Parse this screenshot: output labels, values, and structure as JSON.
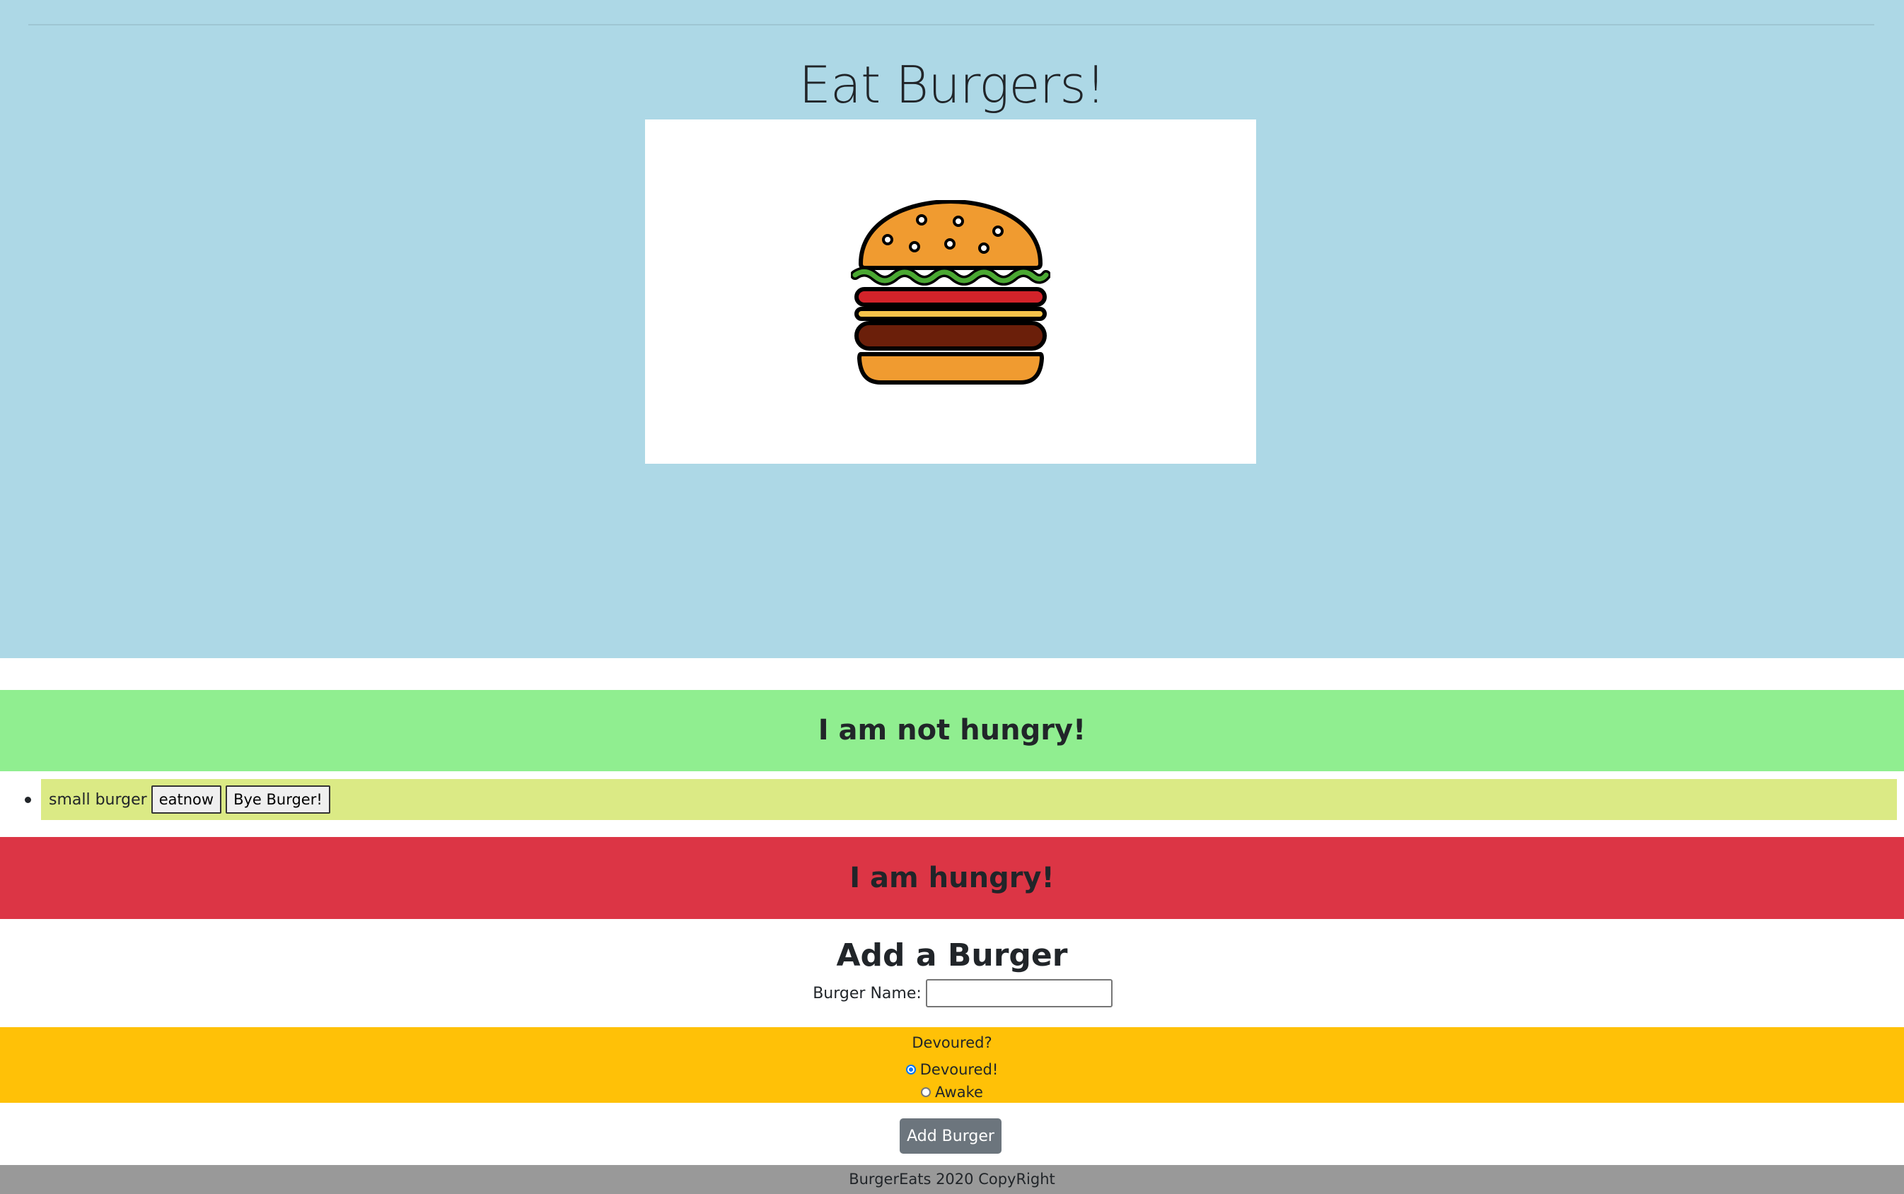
{
  "header": {
    "title": "Eat Burgers!"
  },
  "sections": {
    "not_hungry_title": "I am not hungry!",
    "hungry_title": "I am hungry!"
  },
  "burgers": [
    {
      "name": "small burger",
      "eat_label": "eatnow",
      "delete_label": "Bye Burger!"
    }
  ],
  "form": {
    "title": "Add a Burger",
    "name_label": "Burger Name:",
    "name_value": "",
    "devoured_legend": "Devoured?",
    "options": [
      {
        "label": "Devoured!",
        "checked": true
      },
      {
        "label": "Awake",
        "checked": false
      }
    ],
    "submit_label": "Add Burger"
  },
  "footer": {
    "text": "BurgerEats 2020 CopyRight"
  },
  "colors": {
    "jumbotron": "#add8e6",
    "not_hungry": "#90ee90",
    "hungry": "#dc3545",
    "burger_item": "#dbea85",
    "devoured_box": "#ffc107",
    "submit_button": "#6c757d",
    "footer": "#999999"
  },
  "icons": {
    "hero": "burger-icon"
  }
}
